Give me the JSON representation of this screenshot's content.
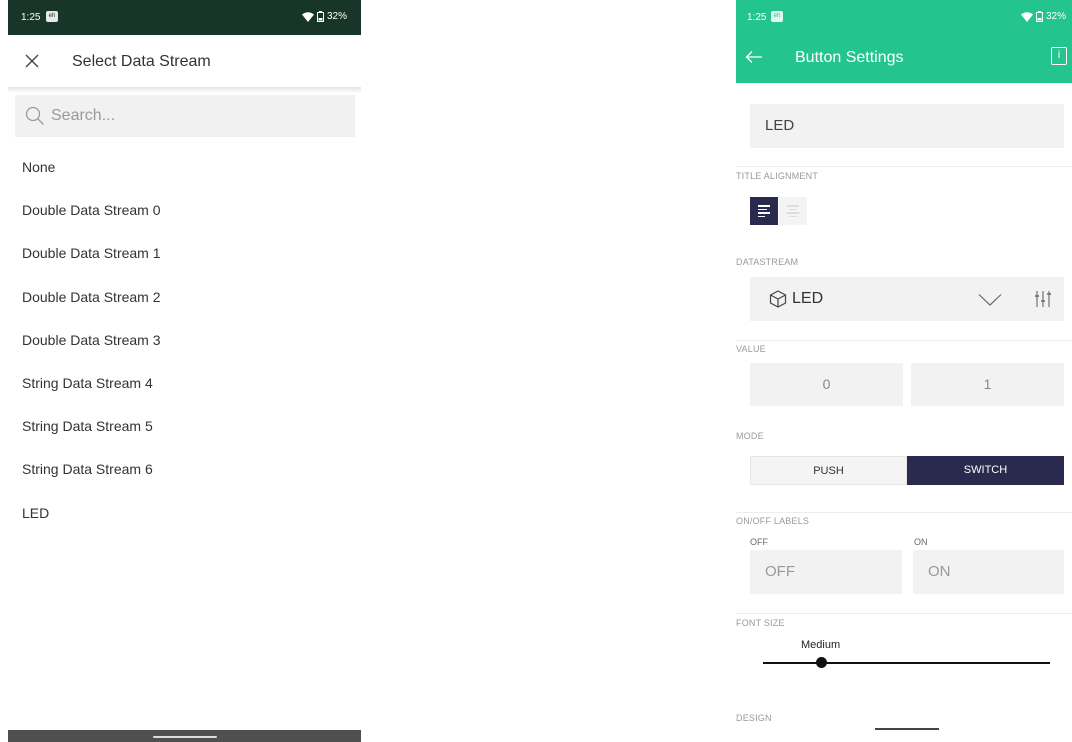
{
  "left_screen": {
    "status_bar": {
      "time": "1:25",
      "badge": "eh",
      "battery": "32%"
    },
    "header": {
      "title": "Select Data Stream",
      "close_icon": "close-icon"
    },
    "search": {
      "placeholder": "Search..."
    },
    "streams": [
      "None",
      "Double Data Stream 0",
      "Double Data Stream 1",
      "Double Data Stream 2",
      "Double Data Stream 3",
      "String Data Stream 4",
      "String Data Stream 5",
      "String Data Stream 6",
      "LED"
    ]
  },
  "right_screen": {
    "status_bar": {
      "time": "1:25",
      "badge": "eh",
      "battery": "32%"
    },
    "header": {
      "title": "Button Settings",
      "info": "i"
    },
    "title_field": {
      "value": "LED"
    },
    "title_alignment": {
      "label": "TITLE ALIGNMENT",
      "selected": "left"
    },
    "datastream": {
      "label": "DATASTREAM",
      "value": "LED"
    },
    "value": {
      "label": "VALUE",
      "low": "0",
      "high": "1"
    },
    "mode": {
      "label": "MODE",
      "push": "PUSH",
      "switch": "SWITCH",
      "selected": "SWITCH"
    },
    "onoff_labels": {
      "label": "ON/OFF LABELS",
      "off_caption": "OFF",
      "on_caption": "ON",
      "off_value": "OFF",
      "on_value": "ON"
    },
    "font_size": {
      "label": "FONT SIZE",
      "value": "Medium"
    },
    "design": {
      "label": "DESIGN"
    }
  },
  "colors": {
    "left_status_bar": "#173629",
    "accent_green": "#23c48e",
    "selected_dark": "#292a4d"
  }
}
